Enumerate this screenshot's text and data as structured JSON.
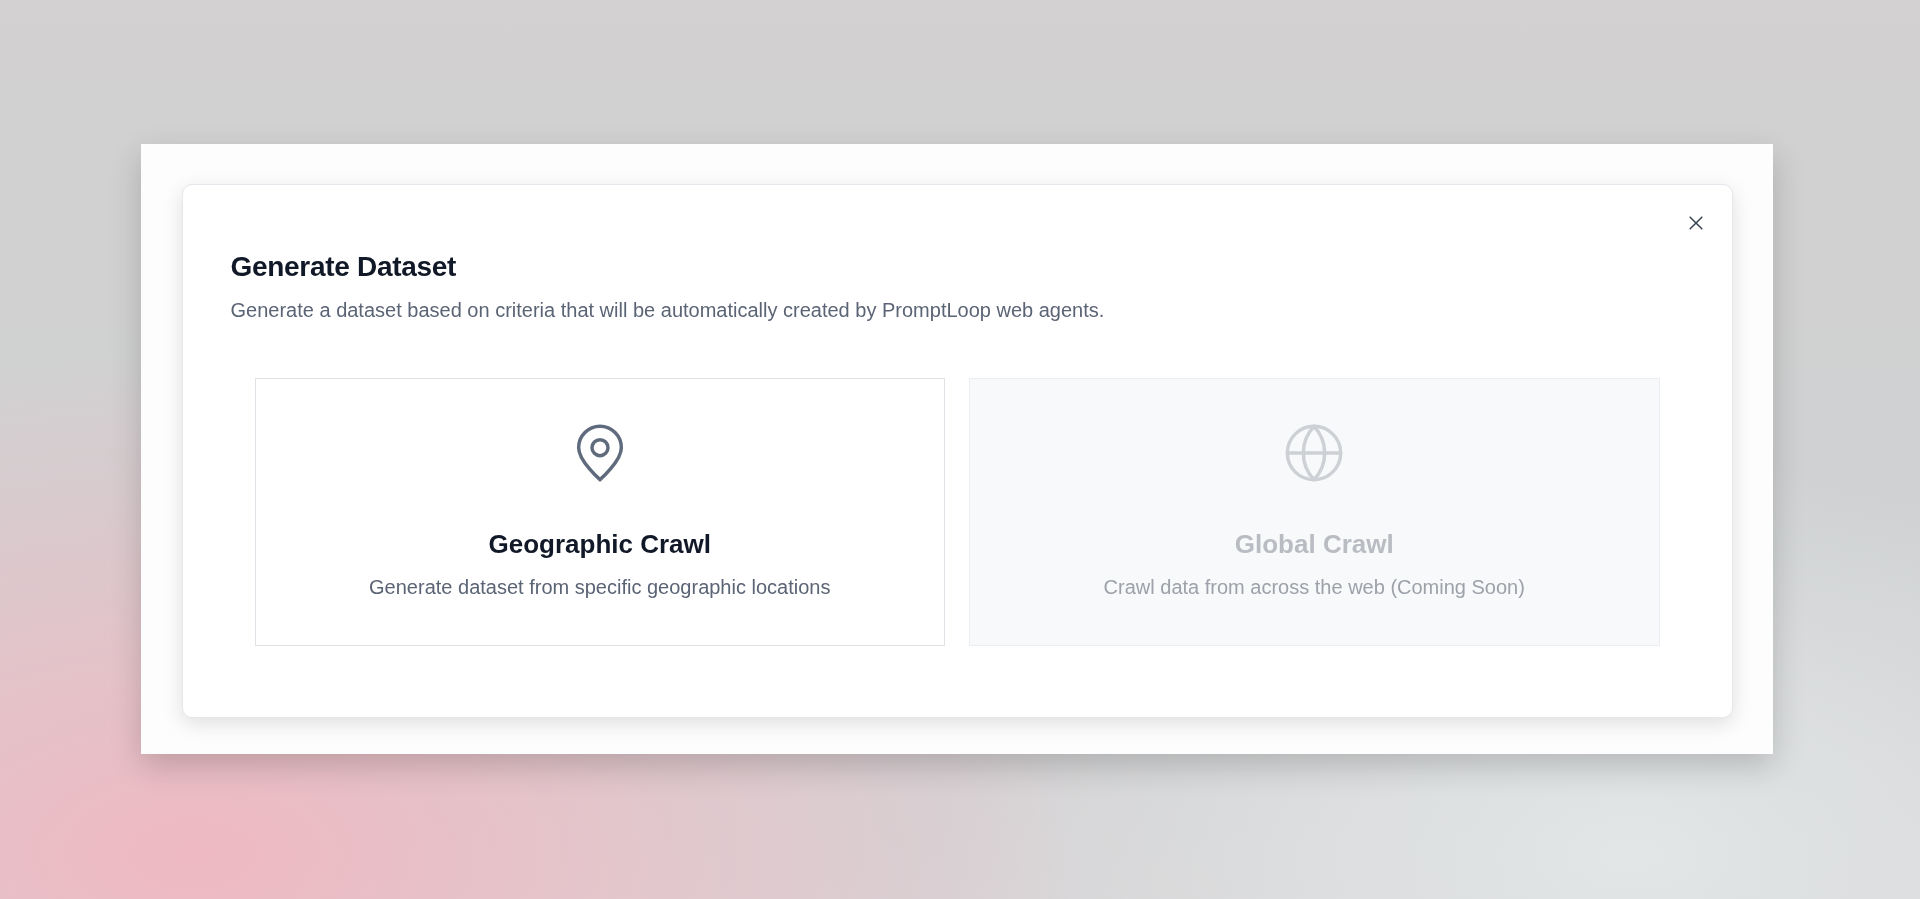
{
  "dialog": {
    "title": "Generate Dataset",
    "description": "Generate a dataset based on criteria that will be automatically created by PromptLoop web agents.",
    "options": [
      {
        "kind": "pin",
        "title": "Geographic Crawl",
        "description": "Generate dataset from specific geographic locations",
        "disabled": false
      },
      {
        "kind": "globe",
        "title": "Global Crawl",
        "description": "Crawl data from across the web (Coming Soon)",
        "disabled": true
      }
    ]
  }
}
